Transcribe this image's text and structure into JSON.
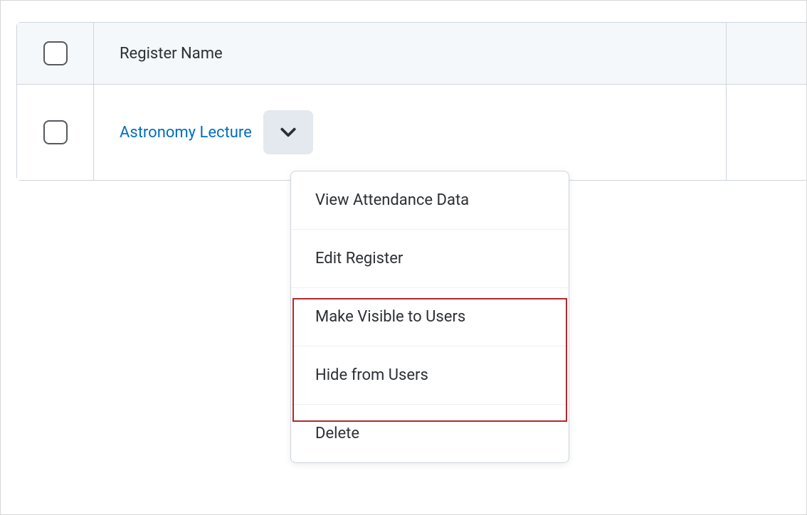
{
  "table": {
    "header": {
      "name_column": "Register Name"
    },
    "rows": [
      {
        "name": "Astronomy Lecture"
      }
    ]
  },
  "dropdown": {
    "items": [
      "View Attendance Data",
      "Edit Register",
      "Make Visible to Users",
      "Hide from Users",
      "Delete"
    ]
  }
}
